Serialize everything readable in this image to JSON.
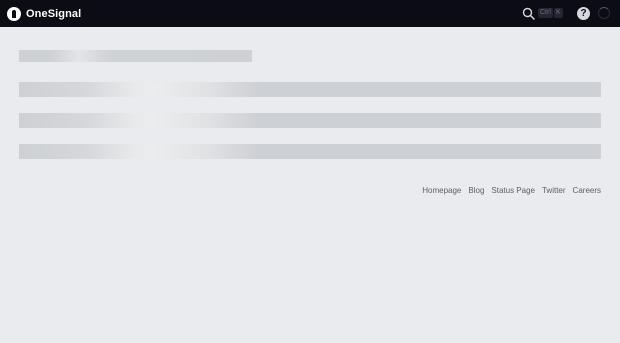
{
  "header": {
    "brand": "OneSignal",
    "search_icon": "search-icon",
    "shortcut_keys": [
      "Ctrl",
      "K"
    ],
    "help_icon": "question-circle-icon",
    "help_glyph": "?",
    "loading_icon": "spinner-icon"
  },
  "footer": {
    "links": [
      "Homepage",
      "Blog",
      "Status Page",
      "Twitter",
      "Careers"
    ]
  },
  "colors": {
    "topbar_bg": "#0b0c14",
    "page_bg": "#e9ebee",
    "skeleton": "#cdd0d4",
    "footer_link": "#5a5f6b"
  }
}
